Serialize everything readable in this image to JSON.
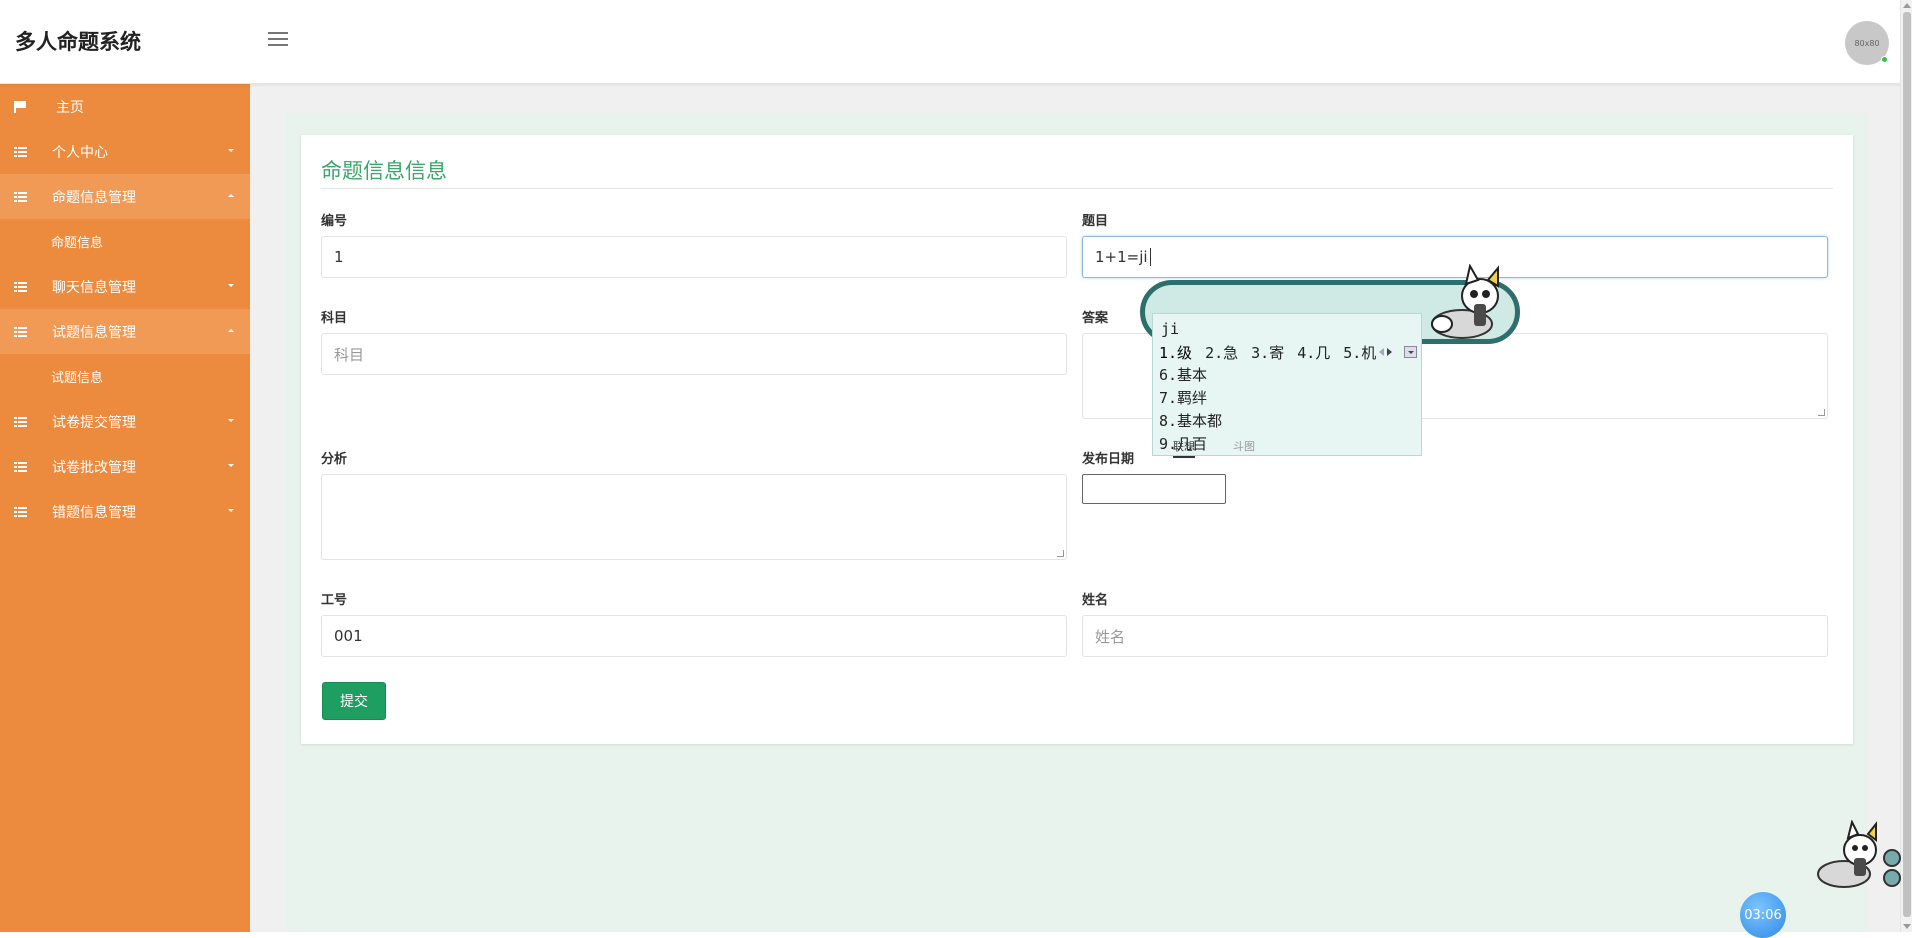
{
  "app": {
    "title": "多人命题系统",
    "avatar_text": "80x80"
  },
  "sidebar": {
    "items": [
      {
        "label": "主页",
        "icon": "flag-icon"
      },
      {
        "label": "个人中心",
        "icon": "grid-icon"
      },
      {
        "label": "命题信息管理",
        "icon": "grid-icon"
      },
      {
        "label": "命题信息"
      },
      {
        "label": "聊天信息管理",
        "icon": "grid-icon"
      },
      {
        "label": "试题信息管理",
        "icon": "grid-icon"
      },
      {
        "label": "试题信息"
      },
      {
        "label": "试卷提交管理",
        "icon": "grid-icon"
      },
      {
        "label": "试卷批改管理",
        "icon": "grid-icon"
      },
      {
        "label": "错题信息管理",
        "icon": "grid-icon"
      }
    ]
  },
  "form": {
    "title": "命题信息信息",
    "fields": {
      "id": {
        "label": "编号",
        "value": "1"
      },
      "question": {
        "label": "题目",
        "value": "1+1=ji"
      },
      "subject": {
        "label": "科目",
        "placeholder": "科目"
      },
      "answer": {
        "label": "答案"
      },
      "analysis": {
        "label": "分析"
      },
      "publish_date": {
        "label": "发布日期"
      },
      "staff_no": {
        "label": "工号",
        "value": "001"
      },
      "name": {
        "label": "姓名",
        "placeholder": "姓名"
      }
    },
    "submit_label": "提交"
  },
  "ime": {
    "pinyin": "ji",
    "candidates_row": [
      "1.级",
      "2.急",
      "3.寄",
      "4.几",
      "5.机"
    ],
    "candidates_list": [
      "6.基本",
      "7.羁绊",
      "8.基本都",
      "9.几百"
    ],
    "tabs": [
      "联想",
      "斗图"
    ]
  },
  "clock": "03:06",
  "colors": {
    "sidebar": "#ec8a3d",
    "accent": "#3aa76c",
    "button": "#1f9e61"
  }
}
